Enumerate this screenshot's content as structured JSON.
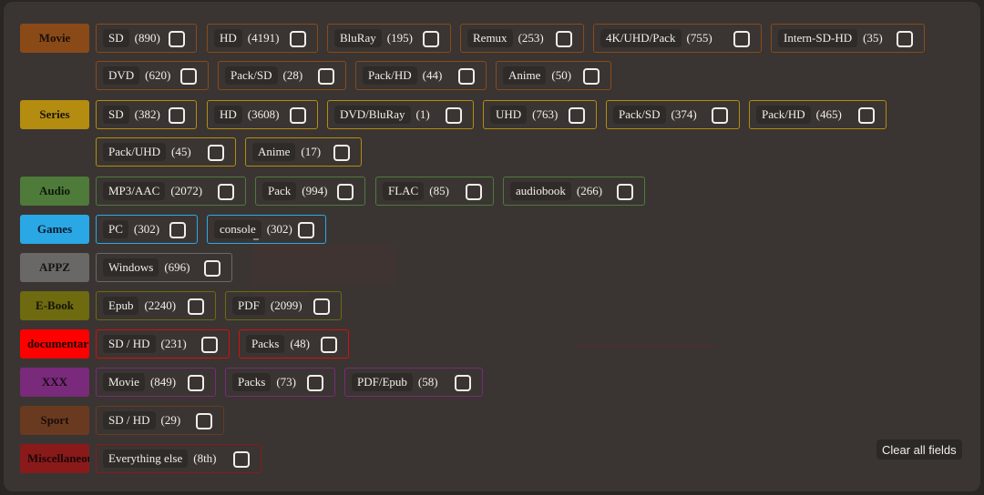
{
  "colors": {
    "movie": "#8a4a18",
    "series": "#b38c10",
    "audio": "#4e7a3a",
    "games": "#2aa8e6",
    "appz": "#6a6866",
    "ebook": "#6e6a10",
    "documentaries": "#ff0000",
    "xxx": "#7a2a7a",
    "sport": "#6a3a20",
    "misc": "#8a1a1a"
  },
  "categories": [
    {
      "label": "Movie",
      "items": [
        {
          "label": "SD",
          "count": "(890)"
        },
        {
          "label": "HD",
          "count": "(4191)"
        },
        {
          "label": "BluRay",
          "count": "(195)"
        },
        {
          "label": "Remux",
          "count": "(253)"
        },
        {
          "label": "4K/UHD/Pack",
          "count": "(755)"
        },
        {
          "label": "Intern-SD-HD",
          "count": "(35)"
        },
        {
          "label": "DVD",
          "count": "(620)"
        },
        {
          "label": "Pack/SD",
          "count": "(28)"
        },
        {
          "label": "Pack/HD",
          "count": "(44)"
        },
        {
          "label": "Anime",
          "count": "(50)"
        }
      ]
    },
    {
      "label": "Series",
      "items": [
        {
          "label": "SD",
          "count": "(382)"
        },
        {
          "label": "HD",
          "count": "(3608)"
        },
        {
          "label": "DVD/BluRay",
          "count": "(1)"
        },
        {
          "label": "UHD",
          "count": "(763)"
        },
        {
          "label": "Pack/SD",
          "count": "(374)"
        },
        {
          "label": "Pack/HD",
          "count": "(465)"
        },
        {
          "label": "Pack/UHD",
          "count": "(45)"
        },
        {
          "label": "Anime",
          "count": "(17)"
        }
      ]
    },
    {
      "label": "Audio",
      "items": [
        {
          "label": "MP3/AAC",
          "count": "(2072)"
        },
        {
          "label": "Pack",
          "count": "(994)"
        },
        {
          "label": "FLAC",
          "count": "(85)"
        },
        {
          "label": "audiobook",
          "count": "(266)"
        }
      ]
    },
    {
      "label": "Games",
      "items": [
        {
          "label": "PC",
          "count": "(302)"
        },
        {
          "label": "console",
          "count": "(302)"
        }
      ]
    },
    {
      "label": "APPZ",
      "items": [
        {
          "label": "Windows",
          "count": "(696)"
        }
      ]
    },
    {
      "label": "E-Book",
      "items": [
        {
          "label": "Epub",
          "count": "(2240)"
        },
        {
          "label": "PDF",
          "count": "(2099)"
        }
      ]
    },
    {
      "label": "documentaries",
      "items": [
        {
          "label": "SD / HD",
          "count": "(231)"
        },
        {
          "label": "Packs",
          "count": "(48)"
        }
      ]
    },
    {
      "label": "XXX",
      "items": [
        {
          "label": "Movie",
          "count": "(849)"
        },
        {
          "label": "Packs",
          "count": "(73)"
        },
        {
          "label": "PDF/Epub",
          "count": "(58)"
        }
      ]
    },
    {
      "label": "Sport",
      "items": [
        {
          "label": "SD / HD",
          "count": "(29)"
        }
      ]
    },
    {
      "label": "Miscellaneous",
      "items": [
        {
          "label": "Everything else",
          "count": "(8th)"
        }
      ]
    }
  ],
  "clear_all_label": "Clear all fields"
}
